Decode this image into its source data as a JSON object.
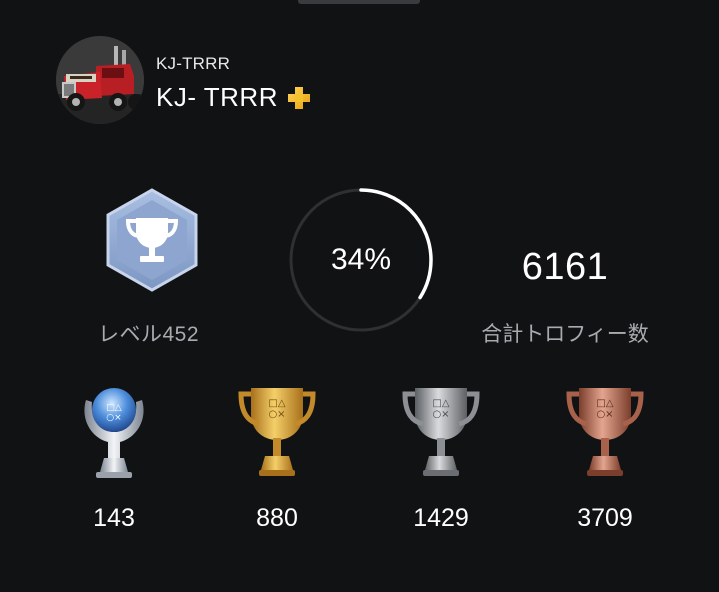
{
  "profile": {
    "online_id": "KJ-TRRR",
    "display_name": "KJ- TRRR",
    "avatar_icon": "truck-avatar-icon",
    "membership_icon": "playstation-plus-icon",
    "membership_color": "#f2b61c"
  },
  "stats": {
    "level_label": "レベル452",
    "progress_label": "34%",
    "progress_fraction": 0.34,
    "total_count": "6161",
    "total_label": "合計トロフィー数"
  },
  "trophies": {
    "platinum": {
      "count": "143",
      "icon": "platinum-trophy-icon"
    },
    "gold": {
      "count": "880",
      "icon": "gold-trophy-icon"
    },
    "silver": {
      "count": "1429",
      "icon": "silver-trophy-icon"
    },
    "bronze": {
      "count": "3709",
      "icon": "bronze-trophy-icon"
    }
  },
  "colors": {
    "background": "#111214",
    "secondary_text": "#a9abb0",
    "ring_track": "#2e3033",
    "ring_fill": "#ffffff",
    "level_badge": "#8fa9d3"
  }
}
